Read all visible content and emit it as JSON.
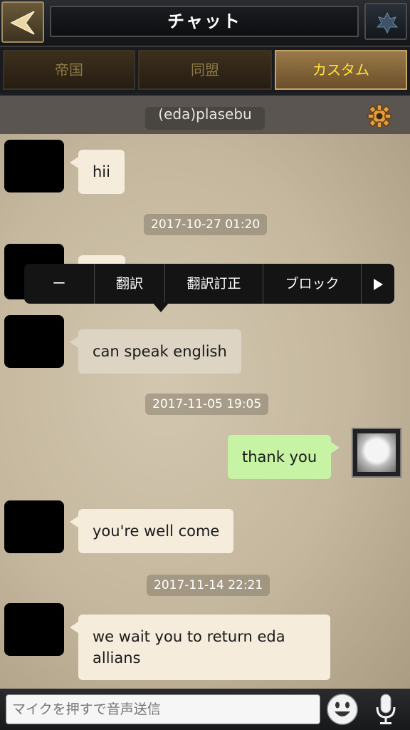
{
  "header": {
    "title": "チャット",
    "back_icon": "back-arrow-icon",
    "emblem_icon": "emblem-icon"
  },
  "tabs": [
    {
      "label": "帝国",
      "active": false
    },
    {
      "label": "同盟",
      "active": false
    },
    {
      "label": "カスタム",
      "active": true
    }
  ],
  "channel": {
    "name": "(eda)plasebu",
    "settings_icon": "gear-icon"
  },
  "messages": [
    {
      "text": "hii"
    },
    {
      "timestamp": "2017-10-27 01:20"
    },
    {
      "text": "can speak english"
    },
    {
      "timestamp": "2017-11-05 19:05"
    },
    {
      "text": "thank you",
      "from_me": true
    },
    {
      "text": "you're well come"
    },
    {
      "timestamp": "2017-11-14 22:21"
    },
    {
      "text": "we wait you to return eda allians"
    }
  ],
  "context_menu": {
    "items": [
      "ー",
      "翻訳",
      "翻訳訂正",
      "ブロック"
    ],
    "more_icon": "play-triangle-icon"
  },
  "input": {
    "placeholder": "マイクを押すで音声送信",
    "emoji_icon": "smiley-icon",
    "mic_icon": "microphone-icon"
  },
  "colors": {
    "active_tab_text": "#ffe23a",
    "my_bubble": "#c7f3a4",
    "other_bubble": "#f5ecdc"
  }
}
